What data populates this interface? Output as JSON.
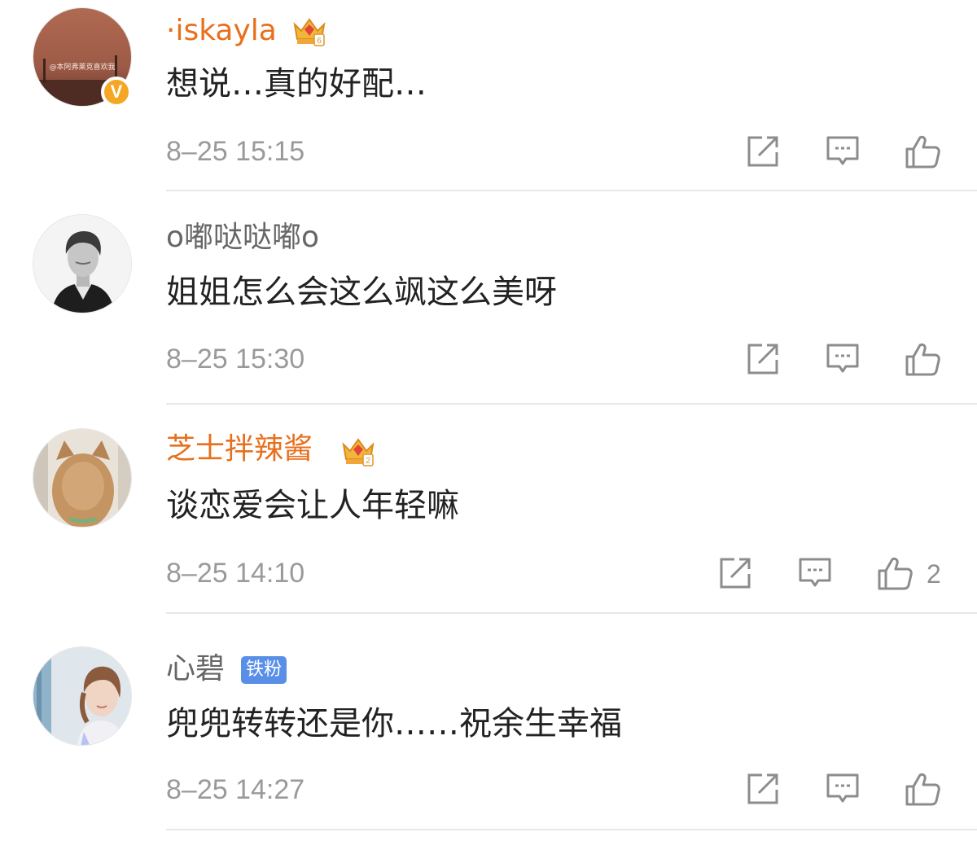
{
  "comments": [
    {
      "username": "·iskayla",
      "text": "想说…真的好配…",
      "time": "8–25 15:15",
      "avatar_watermark": "@本阿弗莱克喜欢我",
      "verified_mark": "V",
      "badge": "crown"
    },
    {
      "username": "o嘟哒哒嘟o",
      "text": "姐姐怎么会这么飒这么美呀",
      "time": "8–25 15:30",
      "badge": "none"
    },
    {
      "username": "芝士拌辣酱",
      "text": "谈恋爱会让人年轻嘛",
      "time": "8–25 14:10",
      "like_count": "2",
      "badge": "crown"
    },
    {
      "username": "心碧",
      "text": "兜兜转转还是你……祝余生幸福",
      "time": "8–25 14:27",
      "fan_badge": "铁粉",
      "badge": "fan"
    }
  ],
  "icons": {
    "share": "share-icon",
    "comment": "comment-icon",
    "like": "like-icon"
  },
  "colors": {
    "vip_name": "#e86f1c",
    "normal_name": "#666666",
    "timestamp": "#9a9a9a",
    "fan_badge_bg": "#5a8fe8",
    "verified_bg": "#f5a623"
  }
}
